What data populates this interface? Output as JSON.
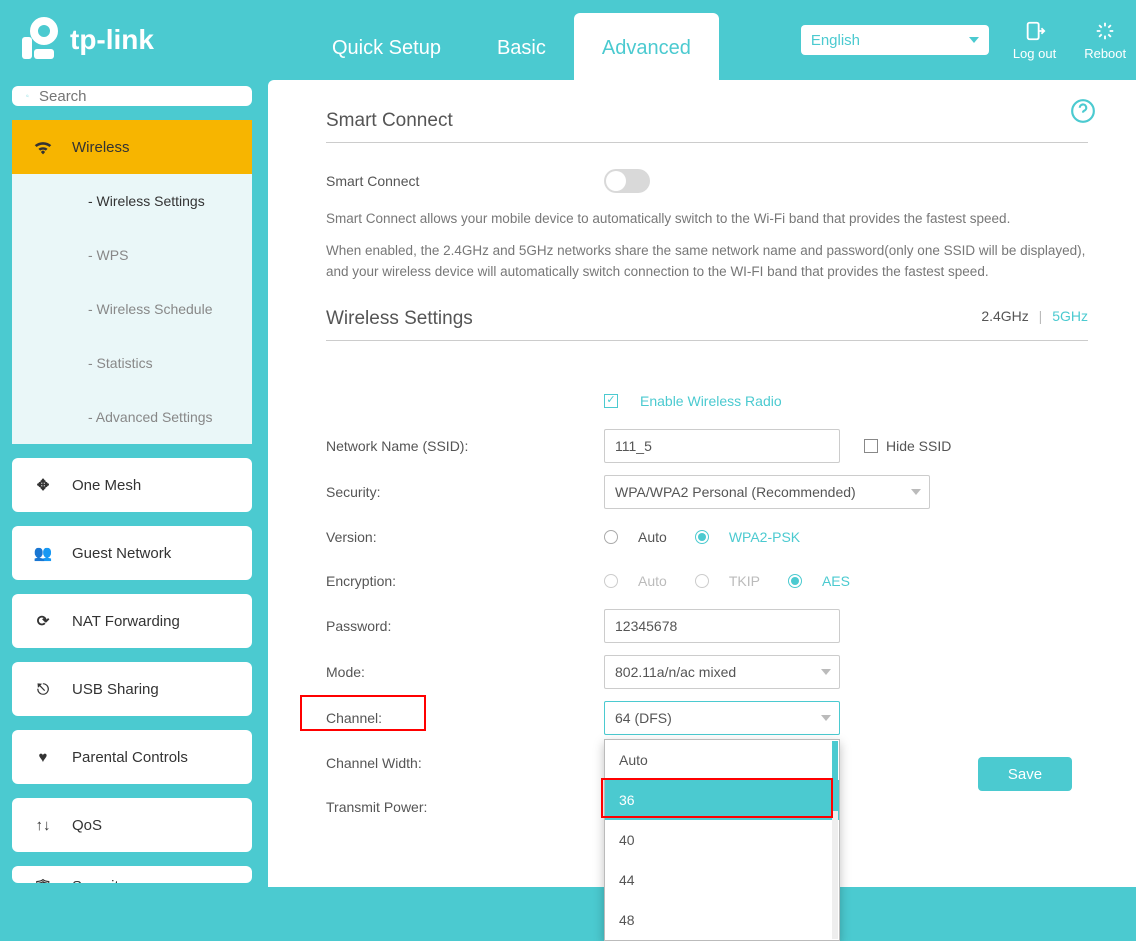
{
  "brand": "tp-link",
  "tabs": {
    "quick_setup": "Quick Setup",
    "basic": "Basic",
    "advanced": "Advanced"
  },
  "language": "English",
  "top_actions": {
    "logout": "Log out",
    "reboot": "Reboot"
  },
  "search": {
    "placeholder": "Search"
  },
  "sidebar": {
    "wireless": "Wireless",
    "sub": {
      "wireless_settings": "- Wireless Settings",
      "wps": "- WPS",
      "wireless_schedule": "- Wireless Schedule",
      "statistics": "- Statistics",
      "advanced_settings": "- Advanced Settings"
    },
    "items": {
      "one_mesh": "One Mesh",
      "guest_network": "Guest Network",
      "nat_forwarding": "NAT Forwarding",
      "usb_sharing": "USB Sharing",
      "parental_controls": "Parental Controls",
      "qos": "QoS",
      "security": "Security"
    }
  },
  "smart_connect": {
    "title": "Smart Connect",
    "label": "Smart Connect",
    "enabled": false,
    "desc1": "Smart Connect allows your mobile device to automatically switch to the Wi-Fi band that provides the fastest speed.",
    "desc2": "When enabled, the 2.4GHz and 5GHz networks share the same network name and password(only one SSID will be displayed), and your wireless device will automatically switch connection to the WI-FI band that provides the fastest speed."
  },
  "wireless_settings": {
    "title": "Wireless Settings",
    "band_24": "2.4GHz",
    "band_5": "5GHz",
    "enable_radio": "Enable Wireless Radio",
    "ssid_label": "Network Name (SSID):",
    "ssid_value": "111_5",
    "hide_ssid": "Hide SSID",
    "security_label": "Security:",
    "security_value": "WPA/WPA2 Personal (Recommended)",
    "version_label": "Version:",
    "version_options": {
      "auto": "Auto",
      "wpa2psk": "WPA2-PSK"
    },
    "encryption_label": "Encryption:",
    "encryption_options": {
      "auto": "Auto",
      "tkip": "TKIP",
      "aes": "AES"
    },
    "password_label": "Password:",
    "password_value": "12345678",
    "mode_label": "Mode:",
    "mode_value": "802.11a/n/ac mixed",
    "channel_label": "Channel:",
    "channel_value": "64 (DFS)",
    "channel_options": [
      "Auto",
      "36",
      "40",
      "44",
      "48"
    ],
    "channel_width_label": "Channel Width:",
    "transmit_power_label": "Transmit Power:",
    "save": "Save"
  }
}
